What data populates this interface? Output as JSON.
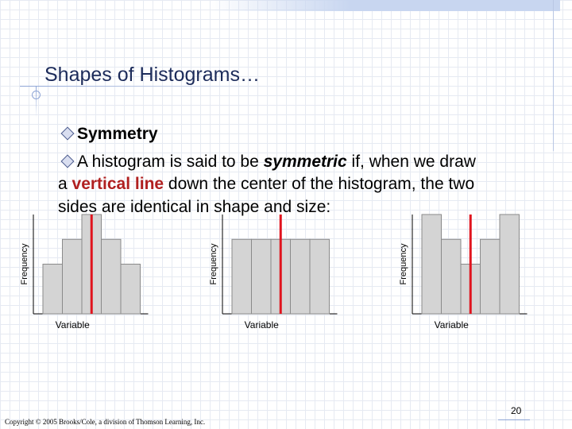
{
  "slide": {
    "title": "Shapes of Histograms…",
    "bullet1": "Symmetry",
    "bullet2_pre": "A histogram is said to be ",
    "bullet2_emph": "symmetric",
    "bullet2_post": " if, when we draw",
    "line2_pre": "a ",
    "line2_red": "vertical line",
    "line2_post": " down the center of the histogram, the two",
    "line3": "sides are identical in shape and size:",
    "footer": "Copyright © 2005 Brooks/Cole, a division of Thomson Learning, Inc.",
    "page_number": "20"
  },
  "colors": {
    "bar_fill": "#d4d4d4",
    "bar_stroke": "#8a8a8a",
    "center_line": "#e0141e",
    "title": "#1c2b5a"
  },
  "chart_data": [
    {
      "type": "bar",
      "title": "",
      "xlabel": "Variable",
      "ylabel": "Frequency",
      "values": [
        2,
        3,
        4,
        3,
        2
      ],
      "ylim": [
        0,
        4
      ],
      "center_line": true
    },
    {
      "type": "bar",
      "title": "",
      "xlabel": "Variable",
      "ylabel": "Frequency",
      "values": [
        3,
        3,
        3,
        3,
        3
      ],
      "ylim": [
        0,
        4
      ],
      "center_line": true
    },
    {
      "type": "bar",
      "title": "",
      "xlabel": "Variable",
      "ylabel": "Frequency",
      "values": [
        4,
        3,
        2,
        3,
        4
      ],
      "ylim": [
        0,
        4
      ],
      "center_line": true
    }
  ]
}
